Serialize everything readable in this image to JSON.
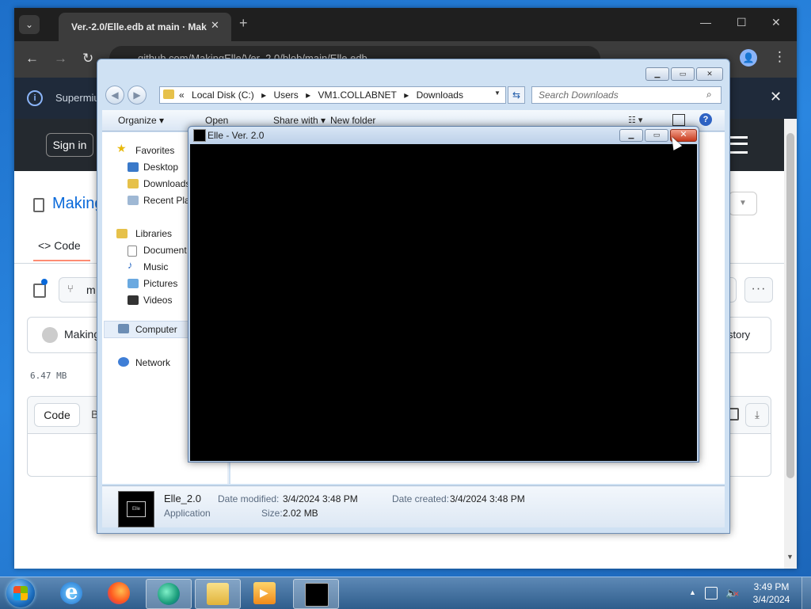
{
  "chrome": {
    "tab_title": "Ver.-2.0/Elle.edb at main · Mak",
    "url": "github.com/MakingElle/Ver.-2.0/blob/main/Elle.edb",
    "notification_text": "Supermiu"
  },
  "github": {
    "signin_label": "Sign in",
    "repo_name": "Making",
    "code_tab_label": "Code",
    "branch_label": "m",
    "commit_author": "Making",
    "history_label": "story",
    "file_size": "6.47 MB",
    "code_toggle_label": "Code",
    "blame_toggle_label": "B"
  },
  "explorer": {
    "address": [
      "«",
      "Local Disk (C:)",
      "▸",
      "Users",
      "▸",
      "VM1.COLLABNET",
      "▸",
      "Downloads"
    ],
    "search_placeholder": "Search Downloads",
    "commands": {
      "organize": "Organize ▾",
      "open": "Open",
      "share": "Share with ▾",
      "new_folder": "New folder"
    },
    "nav": {
      "favorites": "Favorites",
      "desktop": "Desktop",
      "downloads": "Downloads",
      "recent": "Recent Pla",
      "libraries": "Libraries",
      "documents": "Document",
      "music": "Music",
      "pictures": "Pictures",
      "videos": "Videos",
      "computer": "Computer",
      "network": "Network"
    },
    "details": {
      "name": "Elle_2.0",
      "type": "Application",
      "modified_label": "Date modified:",
      "modified_value": "3/4/2024 3:48 PM",
      "created_label": "Date created:",
      "created_value": "3/4/2024 3:48 PM",
      "size_label": "Size:",
      "size_value": "2.02 MB",
      "thumb_text": "Elle"
    }
  },
  "elle_window": {
    "title": "Elle - Ver. 2.0"
  },
  "taskbar": {
    "time": "3:49 PM",
    "date": "3/4/2024"
  }
}
